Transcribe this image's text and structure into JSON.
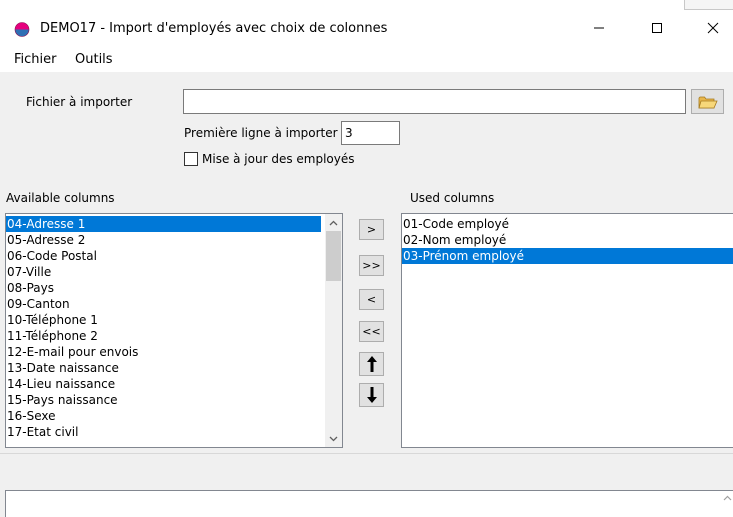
{
  "window": {
    "title": "DEMO17 - Import d'employés avec choix de colonnes"
  },
  "menu": {
    "items": [
      "Fichier",
      "Outils"
    ]
  },
  "form": {
    "file_label": "Fichier à importer",
    "file_value": "",
    "first_line_label": "Première ligne à importer",
    "first_line_value": "3",
    "update_label": "Mise à jour des employés",
    "update_checked": false
  },
  "available": {
    "label": "Available columns",
    "items": [
      "04-Adresse 1",
      "05-Adresse 2",
      "06-Code Postal",
      "07-Ville",
      "08-Pays",
      "09-Canton",
      "10-Téléphone 1",
      "11-Téléphone 2",
      "12-E-mail pour envois",
      "13-Date naissance",
      "14-Lieu naissance",
      "15-Pays naissance",
      "16-Sexe",
      "17-Etat civil"
    ],
    "selected_index": 0
  },
  "used": {
    "label": "Used columns",
    "items": [
      "01-Code employé",
      "02-Nom employé",
      "03-Prénom employé"
    ],
    "selected_index": 2
  },
  "buttons": {
    "add_one": ">",
    "add_all": ">>",
    "remove_one": "<",
    "remove_all": "<<"
  },
  "icons": {
    "app": "app-logo-icon",
    "browse": "folder-open-icon",
    "move_up": "arrow-up-icon",
    "move_down": "arrow-down-icon"
  },
  "colors": {
    "selection": "#0078d7",
    "window_bg": "#f0f0f0"
  }
}
